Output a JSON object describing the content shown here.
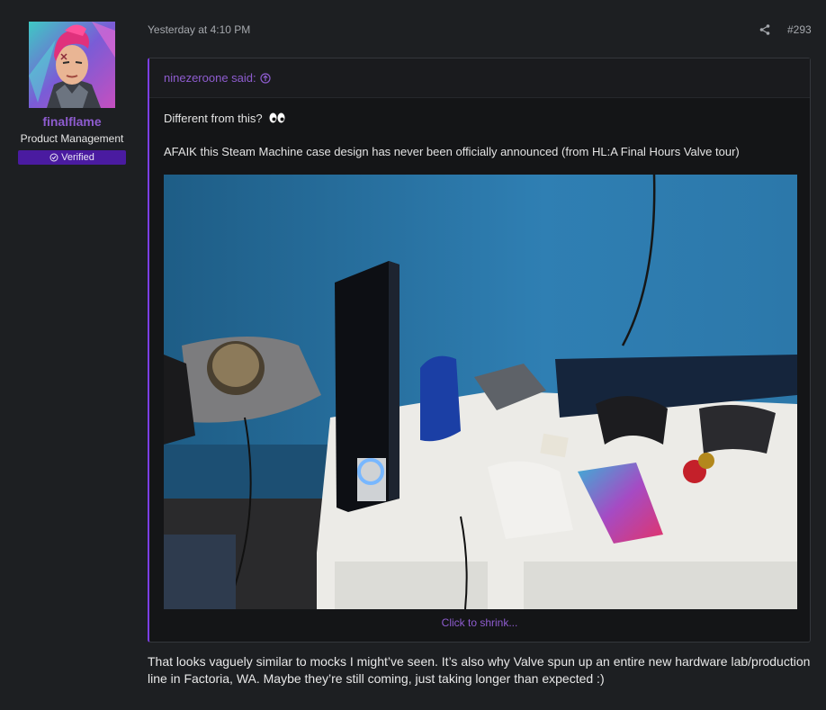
{
  "author": {
    "name": "finalflame",
    "title": "Product Management",
    "badge": "Verified"
  },
  "post": {
    "timestamp": "Yesterday at 4:10 PM",
    "number": "#293",
    "share_icon": "share-icon"
  },
  "quote": {
    "attribution": "ninezeroone said:",
    "line1": "Different from this?",
    "line2": "AFAIK this Steam Machine case design has never been officially announced (from HL:A Final Hours Valve tour)",
    "shrink_label": "Click to shrink..."
  },
  "reply_text": "That looks vaguely similar to mocks I might’ve seen. It’s also why Valve spun up an entire new hardware lab/production line in Factoria, WA. Maybe they’re still coming, just taking longer than expected :)",
  "colors": {
    "accent": "#8e5ccf",
    "badge_bg": "#4a1ba0",
    "quote_border": "#7b3fe4",
    "page_bg": "#1d1f22"
  }
}
